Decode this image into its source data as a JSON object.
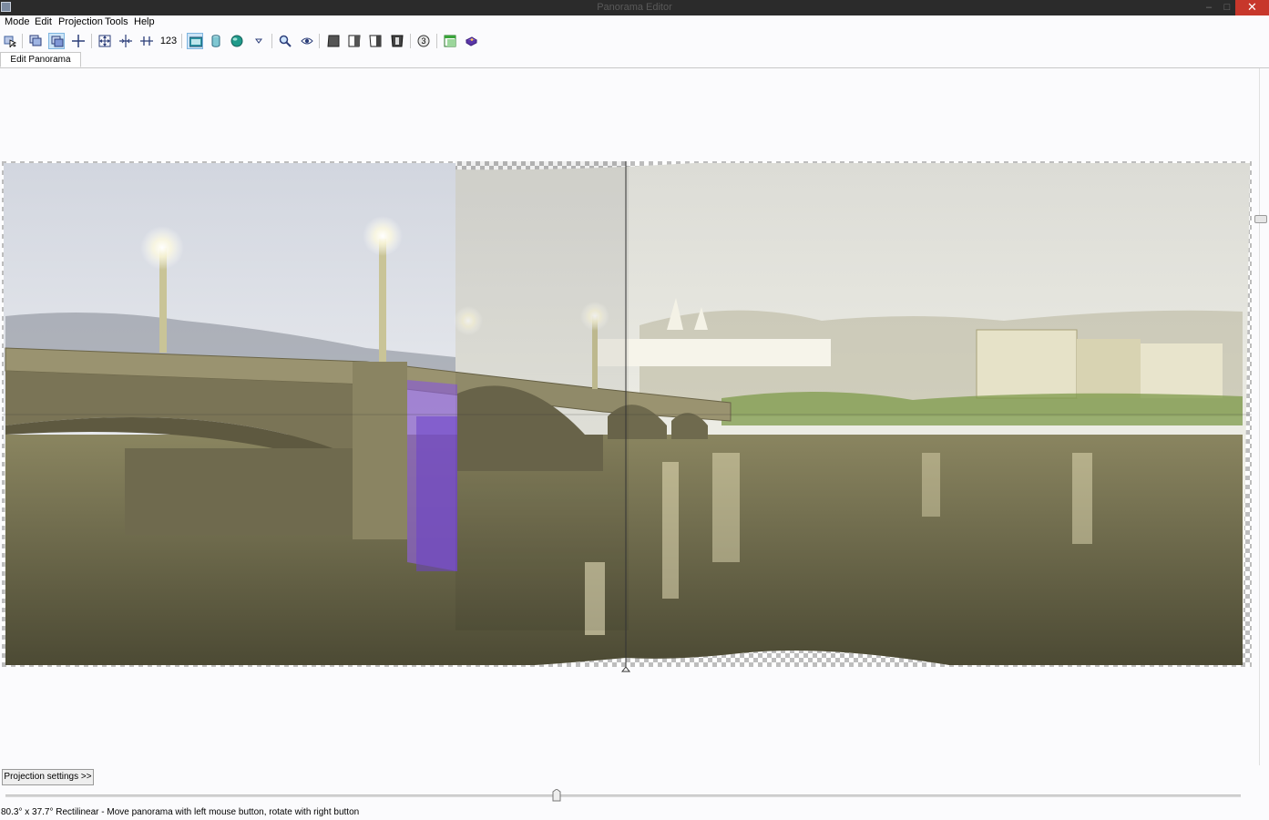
{
  "window": {
    "title": "Panorama Editor",
    "minimize": "–",
    "maximize": "□",
    "close": "✕"
  },
  "menu": [
    "Mode",
    "Edit",
    "Projection",
    "Tools",
    "Help"
  ],
  "toolbar": {
    "number_button_label": "123",
    "badge_label": "3",
    "icons": [
      "select-icon",
      "images-icon",
      "move-drag-icon",
      "crop-icon",
      "fit-icon",
      "center-icon",
      "straighten-icon",
      "number-icon",
      "rectilinear-icon",
      "cylindrical-icon",
      "sphere-icon",
      "more-projections-icon",
      "zoom-icon",
      "preview-eye-icon",
      "blend-left-icon",
      "blend-center-icon",
      "blend-right-icon",
      "blend-full-icon",
      "control-points-icon",
      "layout-icon",
      "stitch-icon"
    ]
  },
  "tabs": [
    {
      "label": "Edit Panorama",
      "active": true
    }
  ],
  "projection_button": "Projection settings >>",
  "status": "80.3° x 37.7° Rectilinear - Move panorama with left mouse button, rotate with right button",
  "colors": {
    "titlebar": "#2b2b2b",
    "close": "#c7372b",
    "toolbar_active": "#cce4f7",
    "water": "#6f6b4a",
    "sky": "#e4e4dc"
  }
}
